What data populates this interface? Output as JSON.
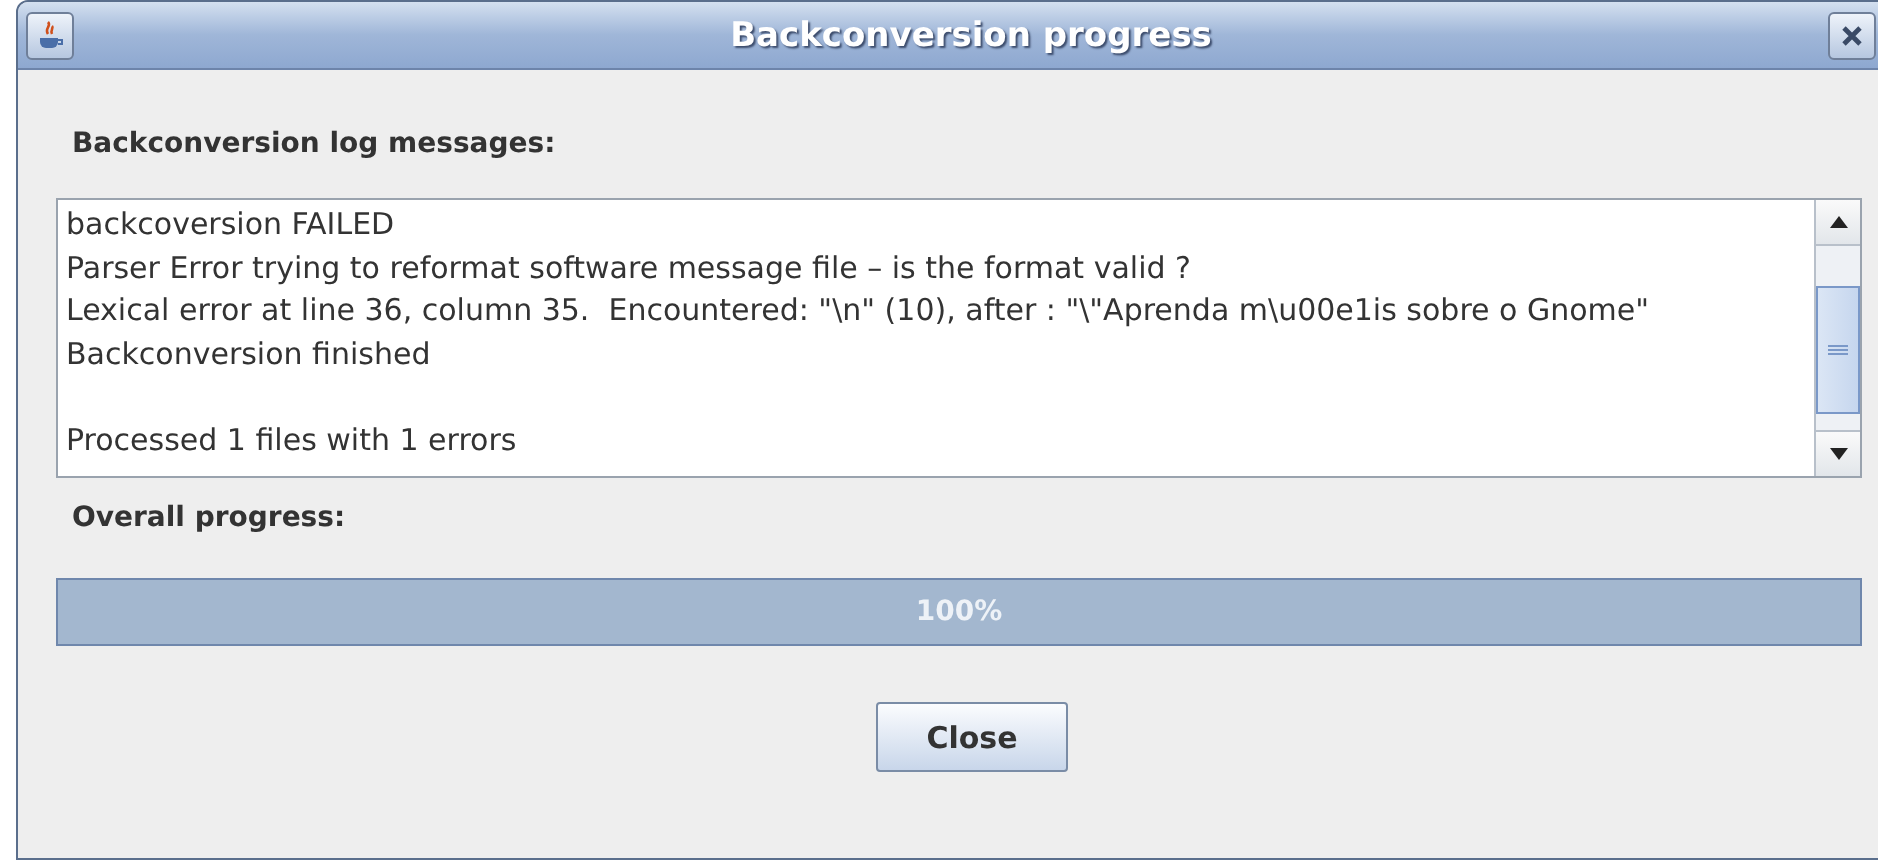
{
  "window": {
    "title": "Backconversion progress"
  },
  "log": {
    "label": "Backconversion log messages:",
    "blocks": [
      {
        "lines": [
          "backcoversion FAILED",
          "Parser Error trying to reformat software message file – is the format valid ?",
          "Lexical error at line 36, column 35.  Encountered: \"\\n\" (10), after : \"\\\"Aprenda m\\u00e1is sobre o Gnome\"",
          "Backconversion finished"
        ]
      },
      {
        "lines": [
          "Processed 1 files with 1 errors"
        ]
      }
    ]
  },
  "progress": {
    "label": "Overall progress:",
    "level": 1,
    "reading": "100%"
  },
  "buttons": [
    {
      "label": "Close"
    }
  ]
}
